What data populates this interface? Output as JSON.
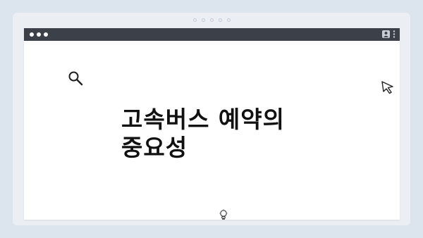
{
  "heading": {
    "line1": "고속버스 예약의",
    "line2": "중요성"
  },
  "icons": {
    "search": "search-icon",
    "cursor": "cursor-icon",
    "user": "user-icon",
    "menu": "kebab-menu-icon",
    "bulb": "lightbulb-icon"
  },
  "colors": {
    "background": "#dce4ee",
    "frame": "#ebeff4",
    "titlebar": "#3c4049",
    "content": "#ffffff",
    "text": "#111111"
  }
}
